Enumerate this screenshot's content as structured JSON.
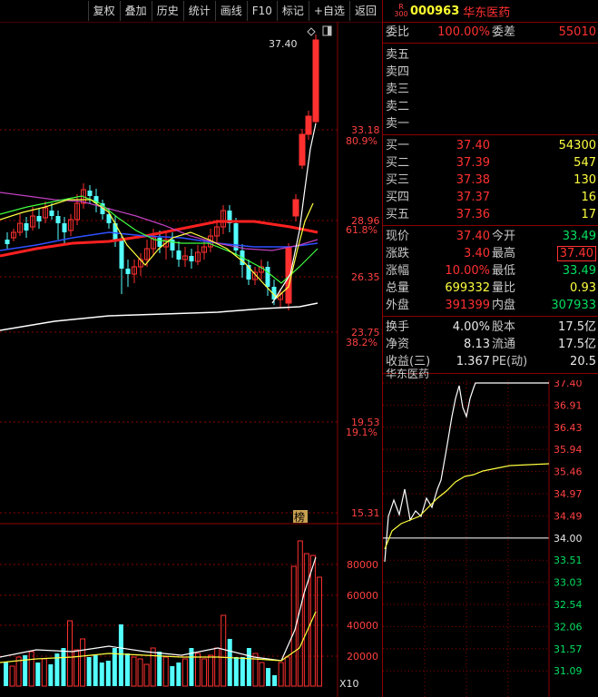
{
  "toolbar": {
    "buttons": [
      "复权",
      "叠加",
      "历史",
      "统计",
      "画线",
      "F10",
      "标记",
      "+自选",
      "返回"
    ]
  },
  "header": {
    "badge_top": "R",
    "badge_bottom": "300",
    "code": "000963",
    "name": "华东医药"
  },
  "kline": {
    "top_price_label": "37.40",
    "price_axis": [
      {
        "value": "33.18",
        "pct": "80.9%"
      },
      {
        "value": "28.96",
        "pct": "61.8%"
      },
      {
        "value": "26.35",
        "pct": ""
      },
      {
        "value": "23.75",
        "pct": "38.2%"
      },
      {
        "value": "19.53",
        "pct": "19.1%"
      },
      {
        "value": "15.31",
        "pct": ""
      }
    ],
    "rank_badge": "榜",
    "volume_axis": [
      "80000",
      "60000",
      "40000",
      "20000"
    ],
    "volume_multiplier": "X10"
  },
  "order": {
    "weibi_label": "委比",
    "weibi_value": "100.00%",
    "weicha_label": "委差",
    "weicha_value": "55010",
    "sell": [
      {
        "label": "卖五"
      },
      {
        "label": "卖四"
      },
      {
        "label": "卖三"
      },
      {
        "label": "卖二"
      },
      {
        "label": "卖一"
      }
    ],
    "buy": [
      {
        "label": "买一",
        "price": "37.40",
        "vol": "54300"
      },
      {
        "label": "买二",
        "price": "37.39",
        "vol": "547"
      },
      {
        "label": "买三",
        "price": "37.38",
        "vol": "130"
      },
      {
        "label": "买四",
        "price": "37.37",
        "vol": "16"
      },
      {
        "label": "买五",
        "price": "37.36",
        "vol": "17"
      }
    ]
  },
  "quote": [
    {
      "l1": "现价",
      "v1": "37.40",
      "c1": "red",
      "l2": "今开",
      "v2": "33.49",
      "c2": "green",
      "b2": false
    },
    {
      "l1": "涨跌",
      "v1": "3.40",
      "c1": "red",
      "l2": "最高",
      "v2": "37.40",
      "c2": "red",
      "b2": true
    },
    {
      "l1": "涨幅",
      "v1": "10.00%",
      "c1": "red",
      "l2": "最低",
      "v2": "33.49",
      "c2": "green",
      "b2": false
    },
    {
      "l1": "总量",
      "v1": "699332",
      "c1": "yellow",
      "l2": "量比",
      "v2": "0.93",
      "c2": "yellow",
      "b2": false
    },
    {
      "l1": "外盘",
      "v1": "391399",
      "c1": "red",
      "l2": "内盘",
      "v2": "307933",
      "c2": "green",
      "b2": false
    }
  ],
  "fund": [
    {
      "l1": "换手",
      "v1": "4.00%",
      "l2": "股本",
      "v2": "17.5亿"
    },
    {
      "l1": "净资",
      "v1": "8.13",
      "l2": "流通",
      "v2": "17.5亿"
    },
    {
      "l1": "收益(三)",
      "v1": "1.367",
      "l2": "PE(动)",
      "v2": "20.5"
    }
  ],
  "mini": {
    "title": "华东医药",
    "axis": [
      {
        "v": "37.40",
        "c": "red"
      },
      {
        "v": "36.91",
        "c": "red"
      },
      {
        "v": "36.43",
        "c": "red"
      },
      {
        "v": "35.94",
        "c": "red"
      },
      {
        "v": "35.46",
        "c": "red"
      },
      {
        "v": "34.97",
        "c": "red"
      },
      {
        "v": "34.49",
        "c": "red"
      },
      {
        "v": "34.00",
        "c": "white"
      },
      {
        "v": "33.51",
        "c": "green"
      },
      {
        "v": "33.03",
        "c": "green"
      },
      {
        "v": "32.54",
        "c": "green"
      },
      {
        "v": "32.06",
        "c": "green"
      },
      {
        "v": "31.57",
        "c": "green"
      },
      {
        "v": "31.09",
        "c": "green"
      }
    ]
  },
  "colors": {
    "up": "#ff3030",
    "down": "#54ffff",
    "grid": "#8b0000",
    "ma_red": "#ff2020"
  }
}
